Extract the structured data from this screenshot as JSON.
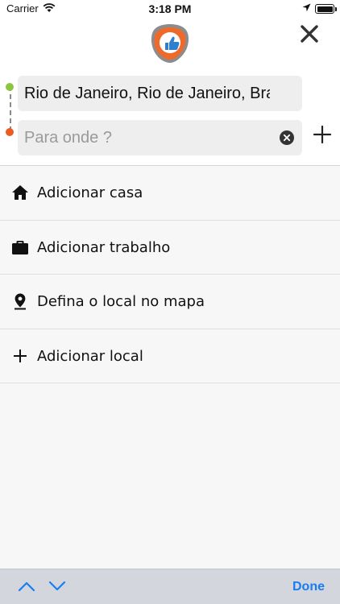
{
  "status_bar": {
    "carrier": "Carrier",
    "time": "3:18 PM"
  },
  "header": {
    "logo_icon": "thumbs-up-shield-logo",
    "close_icon": "close-icon"
  },
  "route": {
    "origin_value": "Rio de Janeiro, Rio de Janeiro, Brasil",
    "destination_placeholder": "Para onde ?",
    "origin_dot_color": "#8cc63f",
    "destination_dot_color": "#ee5a24"
  },
  "menu": {
    "items": [
      {
        "label": "Adicionar casa",
        "icon": "home-icon"
      },
      {
        "label": "Adicionar trabalho",
        "icon": "briefcase-icon"
      },
      {
        "label": "Defina o local no mapa",
        "icon": "map-pin-icon"
      },
      {
        "label": "Adicionar local",
        "icon": "plus-icon"
      }
    ]
  },
  "keyboard_toolbar": {
    "done_label": "Done",
    "accent": "#1a7cf5"
  }
}
